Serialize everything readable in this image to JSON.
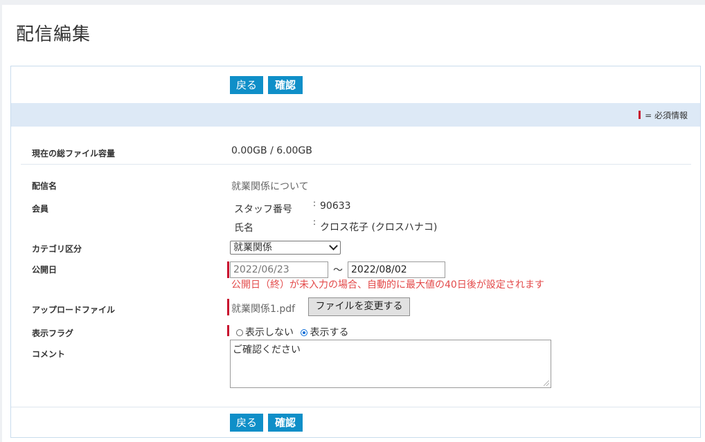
{
  "page": {
    "title": "配信編集"
  },
  "buttons": {
    "back_label": "戻る",
    "confirm_label": "確認"
  },
  "required_legend": "= 必須情報",
  "fields": {
    "storage": {
      "label": "現在の総ファイル容量",
      "value": "0.00GB / 6.00GB"
    },
    "delivery_name": {
      "label": "配信名",
      "value": "就業関係について"
    },
    "member": {
      "label": "会員",
      "staff_no_label": "スタッフ番号",
      "staff_no_value": "90633",
      "name_label": "氏名",
      "name_value": "クロス花子 (クロスハナコ)",
      "separator": ":"
    },
    "category": {
      "label": "カテゴリ区分",
      "selected": "就業関係"
    },
    "publish_date": {
      "label": "公開日",
      "start": "2022/06/23",
      "end": "2022/08/02",
      "range_sep": "〜",
      "warning": "公開日（終）が未入力の場合、自動的に最大値の40日後が設定されます"
    },
    "upload_file": {
      "label": "アップロードファイル",
      "filename": "就業関係1.pdf",
      "change_button": "ファイルを変更する"
    },
    "display_flag": {
      "label": "表示フラグ",
      "options": [
        {
          "label": "表示しない",
          "checked": false
        },
        {
          "label": "表示する",
          "checked": true
        }
      ]
    },
    "comment": {
      "label": "コメント",
      "value": "ご確認ください"
    }
  },
  "colors": {
    "accent": "#0f8fc8",
    "required": "#c8102e",
    "warning": "#e34a4a",
    "band": "#dde9f6"
  }
}
